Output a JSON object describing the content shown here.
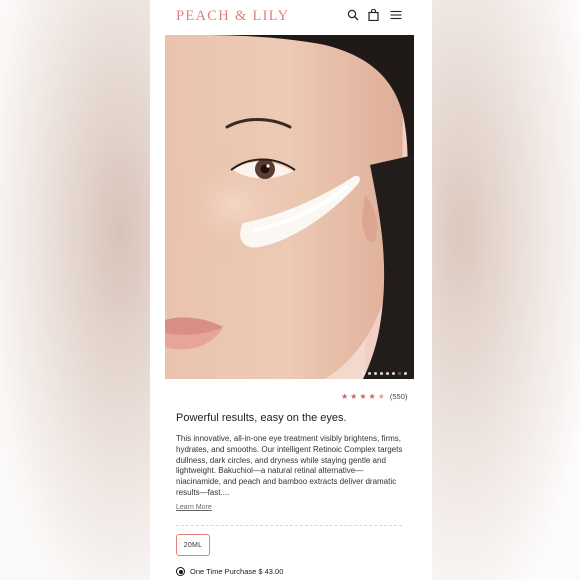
{
  "header": {
    "logo": "PEACH & LILY",
    "icons": [
      "search-icon",
      "bag-icon",
      "menu-icon"
    ]
  },
  "gallery": {
    "slide_count": 8,
    "active_slide": 7
  },
  "rating": {
    "stars": 4.5,
    "count": "(550)"
  },
  "product": {
    "headline": "Powerful results, easy on the eyes.",
    "description": "This innovative, all-in-one eye treatment visibly brightens, firms, hydrates, and smooths. Our intelligent Retinoic Complex targets dullness, dark circles, and dryness while staying gentle and lightweight. Bakuchiol—a natural retinal alternative—niacinamide, and peach and bamboo extracts deliver dramatic results—fast....",
    "learn_more": "Learn More"
  },
  "size": {
    "selected": "20ML"
  },
  "purchase": {
    "option": "One Time Purchase $ 43.00"
  },
  "colors": {
    "brand": "#e1827c",
    "star": "#d0605a"
  }
}
